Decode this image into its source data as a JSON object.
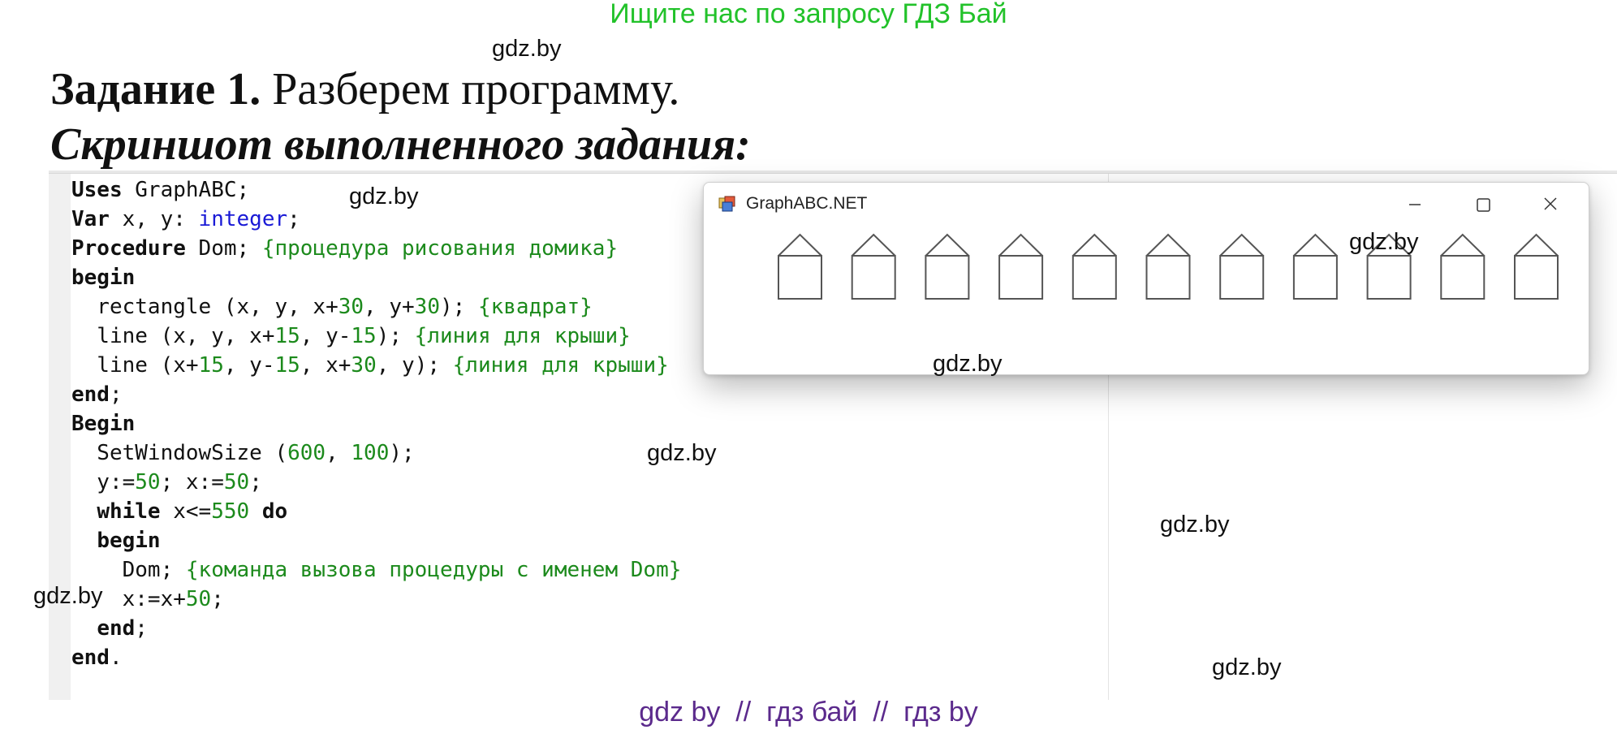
{
  "banner": "Ищите нас по запросу ГДЗ Бай",
  "watermark": "gdz.by",
  "task": {
    "number": "Задание 1.",
    "text": " Разберем программу.",
    "subtitle": "Скриншот выполненного задания:"
  },
  "code": {
    "lines": [
      [
        {
          "t": "Uses",
          "c": "kw"
        },
        {
          "t": " GraphABC;"
        }
      ],
      [
        {
          "t": "Var",
          "c": "kw"
        },
        {
          "t": " x, y: "
        },
        {
          "t": "integer",
          "c": "type"
        },
        {
          "t": ";"
        }
      ],
      [
        {
          "t": "Procedure",
          "c": "kw"
        },
        {
          "t": " Dom; "
        },
        {
          "t": "{процедура рисования домика}",
          "c": "cm"
        }
      ],
      [
        {
          "t": "begin",
          "c": "kw"
        }
      ],
      [
        {
          "t": "  rectangle (x, y, x+"
        },
        {
          "t": "30",
          "c": "num"
        },
        {
          "t": ", y+"
        },
        {
          "t": "30",
          "c": "num"
        },
        {
          "t": "); "
        },
        {
          "t": "{квадрат}",
          "c": "cm"
        }
      ],
      [
        {
          "t": "  line (x, y, x+"
        },
        {
          "t": "15",
          "c": "num"
        },
        {
          "t": ", y-"
        },
        {
          "t": "15",
          "c": "num"
        },
        {
          "t": "); "
        },
        {
          "t": "{линия для крыши}",
          "c": "cm"
        }
      ],
      [
        {
          "t": "  line (x+"
        },
        {
          "t": "15",
          "c": "num"
        },
        {
          "t": ", y-"
        },
        {
          "t": "15",
          "c": "num"
        },
        {
          "t": ", x+"
        },
        {
          "t": "30",
          "c": "num"
        },
        {
          "t": ", y); "
        },
        {
          "t": "{линия для крыши}",
          "c": "cm"
        }
      ],
      [
        {
          "t": "end",
          "c": "kw"
        },
        {
          "t": ";"
        }
      ],
      [
        {
          "t": "Begin",
          "c": "kw"
        }
      ],
      [
        {
          "t": "  SetWindowSize ("
        },
        {
          "t": "600",
          "c": "num"
        },
        {
          "t": ", "
        },
        {
          "t": "100",
          "c": "num"
        },
        {
          "t": ");"
        }
      ],
      [
        {
          "t": "  y:="
        },
        {
          "t": "50",
          "c": "num"
        },
        {
          "t": "; x:="
        },
        {
          "t": "50",
          "c": "num"
        },
        {
          "t": ";"
        }
      ],
      [
        {
          "t": "  "
        },
        {
          "t": "while",
          "c": "kw"
        },
        {
          "t": " x<="
        },
        {
          "t": "550",
          "c": "num"
        },
        {
          "t": " "
        },
        {
          "t": "do",
          "c": "kw"
        }
      ],
      [
        {
          "t": "  "
        },
        {
          "t": "begin",
          "c": "kw"
        }
      ],
      [
        {
          "t": "    Dom; "
        },
        {
          "t": "{команда вызова процедуры с именем Dom}",
          "c": "cm"
        }
      ],
      [
        {
          "t": "    x:=x+"
        },
        {
          "t": "50",
          "c": "num"
        },
        {
          "t": ";"
        }
      ],
      [
        {
          "t": "  "
        },
        {
          "t": "end",
          "c": "kw"
        },
        {
          "t": ";"
        }
      ],
      [
        {
          "t": "end",
          "c": "kw"
        },
        {
          "t": "."
        }
      ]
    ]
  },
  "window": {
    "title": "GraphABC.NET",
    "house_count": 11
  },
  "footer": "gdz by  //  гдз бай  //  гдз by",
  "colors": {
    "banner": "#22c22a",
    "footer": "#5b2a8c",
    "keyword_type": "#1a1ad6",
    "number_comment": "#1c8a1c"
  }
}
